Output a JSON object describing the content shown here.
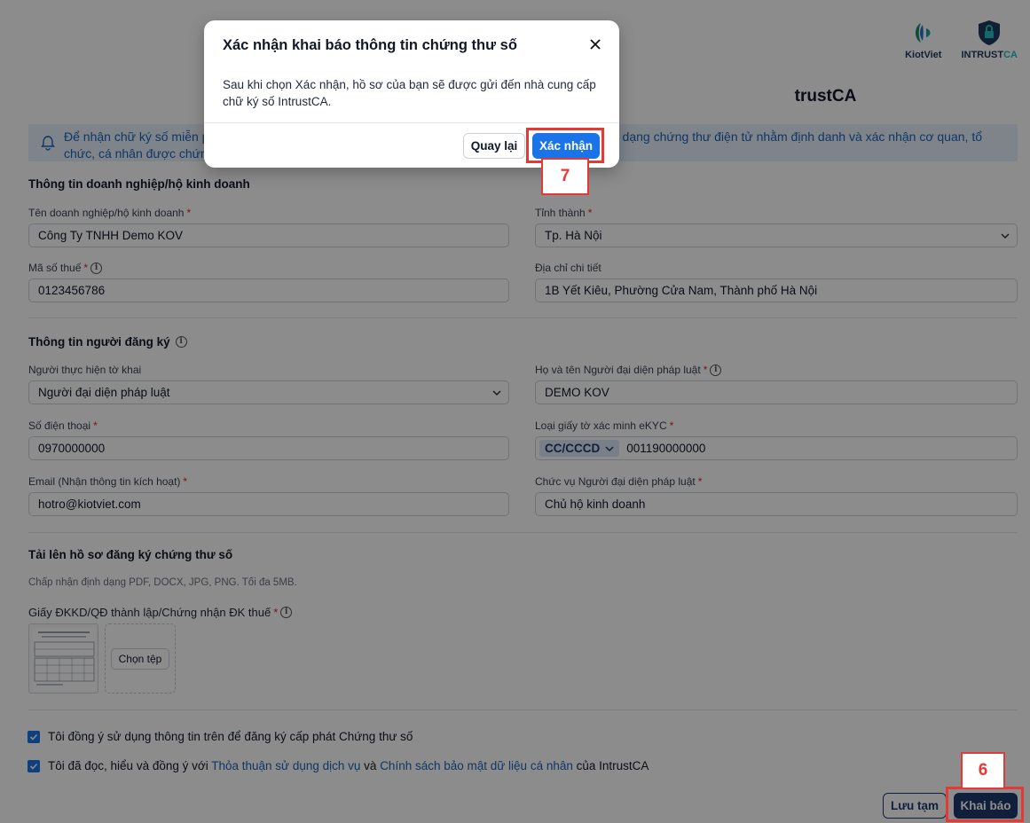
{
  "logos": {
    "kiotviet": "KiotViet",
    "intrust_prefix": "INTRUST",
    "intrust_suffix": "CA"
  },
  "page": {
    "title_fragment": "trustCA",
    "notice_line1": "Để nhận chữ ký số miễn ph",
    "notice_line1_tail": "một dạng chứng thư điện tử nhằm định danh và xác nhận cơ quan, tổ",
    "notice_line2": "chức, cá nhân được chứng"
  },
  "business": {
    "section_title": "Thông tin doanh nghiệp/hộ kinh doanh",
    "name_label": "Tên doanh nghiệp/hộ kinh doanh",
    "name_value": "Công Ty TNHH Demo KOV",
    "province_label": "Tỉnh thành",
    "province_value": "Tp. Hà Nội",
    "tax_label": "Mã số thuế",
    "tax_value": "0123456786",
    "address_label": "Địa chỉ chi tiết",
    "address_value": "1B Yết Kiêu, Phường Cửa Nam, Thành phố Hà Nội"
  },
  "registrant": {
    "section_title": "Thông tin người đăng ký",
    "performer_label": "Người thực hiện tờ khai",
    "performer_value": "Người đại diện pháp luật",
    "legal_name_label": "Họ và tên Người đại diện pháp luật",
    "legal_name_value": "DEMO KOV",
    "phone_label": "Số điện thoại",
    "phone_value": "0970000000",
    "id_type_label": "Loại giấy tờ xác minh eKYC",
    "id_type_value": "CC/CCCD",
    "id_number_value": "001190000000",
    "email_label": "Email (Nhận thông tin kích hoạt)",
    "email_value": "hotro@kiotviet.com",
    "position_label": "Chức vụ Người đại diện pháp luật",
    "position_value": "Chủ hộ kinh doanh"
  },
  "upload": {
    "section_title": "Tải lên hồ sơ đăng ký chứng thư số",
    "hint": "Chấp nhận định dạng PDF, DOCX, JPG, PNG. Tối đa 5MB.",
    "doc_label": "Giấy ĐKKD/QĐ thành lập/Chứng nhận ĐK thuế",
    "choose_label": "Chọn tệp"
  },
  "agreements": {
    "consent1": "Tôi đồng ý sử dụng thông tin trên để đăng ký cấp phát Chứng thư số",
    "consent2_prefix": "Tôi đã đọc, hiểu và đồng ý với",
    "consent2_link1": "Thỏa thuận sử dụng dịch vụ",
    "consent2_and": "và",
    "consent2_link2": "Chính sách bảo mật dữ liệu cá nhân",
    "consent2_suffix": "của IntrustCA"
  },
  "actions": {
    "save_draft": "Lưu tạm",
    "submit": "Khai báo"
  },
  "modal": {
    "title": "Xác nhận khai báo thông tin chứng thư số",
    "body": "Sau khi chọn Xác nhận, hồ sơ của bạn sẽ được gửi đến nhà cung cấp chữ ký số IntrustCA.",
    "back_label": "Quay lại",
    "confirm_label": "Xác nhận"
  },
  "annotations": {
    "step_confirm": "7",
    "step_submit": "6"
  },
  "colors": {
    "primary_blue": "#1a73e8",
    "navy": "#1e3a6e",
    "highlight_red": "#e53935",
    "notice_bg": "#e6f0fb"
  }
}
